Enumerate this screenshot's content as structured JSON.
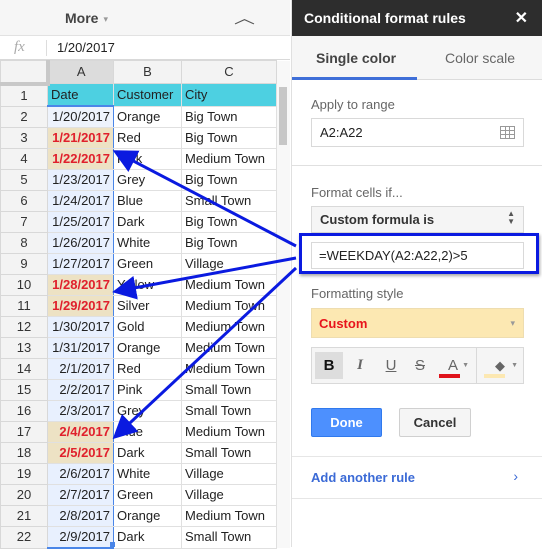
{
  "toolbar": {
    "more_label": "More",
    "more_caret": "▾",
    "collapse_icon": "︿"
  },
  "formula_bar": {
    "fx_label": "fx",
    "value": "1/20/2017"
  },
  "columns": [
    "A",
    "B",
    "C"
  ],
  "rows": [
    {
      "n": "1",
      "a": "Date",
      "b": "Customer",
      "c": "City"
    },
    {
      "n": "2",
      "a": "1/20/2017",
      "b": "Orange",
      "c": "Big Town"
    },
    {
      "n": "3",
      "a": "1/21/2017",
      "b": "Red",
      "c": "Big Town"
    },
    {
      "n": "4",
      "a": "1/22/2017",
      "b": "Pink",
      "c": "Medium Town"
    },
    {
      "n": "5",
      "a": "1/23/2017",
      "b": "Grey",
      "c": "Big Town"
    },
    {
      "n": "6",
      "a": "1/24/2017",
      "b": "Blue",
      "c": "Small Town"
    },
    {
      "n": "7",
      "a": "1/25/2017",
      "b": "Dark",
      "c": "Big Town"
    },
    {
      "n": "8",
      "a": "1/26/2017",
      "b": "White",
      "c": "Big Town"
    },
    {
      "n": "9",
      "a": "1/27/2017",
      "b": "Green",
      "c": "Village"
    },
    {
      "n": "10",
      "a": "1/28/2017",
      "b": "Yellow",
      "c": "Medium Town"
    },
    {
      "n": "11",
      "a": "1/29/2017",
      "b": "Silver",
      "c": "Medium Town"
    },
    {
      "n": "12",
      "a": "1/30/2017",
      "b": "Gold",
      "c": "Medium Town"
    },
    {
      "n": "13",
      "a": "1/31/2017",
      "b": "Orange",
      "c": "Medium Town"
    },
    {
      "n": "14",
      "a": "2/1/2017",
      "b": "Red",
      "c": "Medium Town"
    },
    {
      "n": "15",
      "a": "2/2/2017",
      "b": "Pink",
      "c": "Small Town"
    },
    {
      "n": "16",
      "a": "2/3/2017",
      "b": "Grey",
      "c": "Small Town"
    },
    {
      "n": "17",
      "a": "2/4/2017",
      "b": "Blue",
      "c": "Medium Town"
    },
    {
      "n": "18",
      "a": "2/5/2017",
      "b": "Dark",
      "c": "Small Town"
    },
    {
      "n": "19",
      "a": "2/6/2017",
      "b": "White",
      "c": "Village"
    },
    {
      "n": "20",
      "a": "2/7/2017",
      "b": "Green",
      "c": "Village"
    },
    {
      "n": "21",
      "a": "2/8/2017",
      "b": "Orange",
      "c": "Medium Town"
    },
    {
      "n": "22",
      "a": "2/9/2017",
      "b": "Dark",
      "c": "Small Town"
    }
  ],
  "highlighted_rows": [
    "3",
    "4",
    "10",
    "11",
    "17",
    "18"
  ],
  "colors": {
    "header_fill": "#4dd0e1",
    "highlight_fill": "#ede2c4",
    "highlight_text": "#e0202c",
    "selection": "#4a86e8",
    "annotation": "#0a1ae0",
    "done_button": "#4d90fe",
    "link": "#3b6ad6"
  },
  "panel": {
    "title": "Conditional format rules",
    "close_icon": "✕",
    "tabs": [
      {
        "label": "Single color",
        "active": true
      },
      {
        "label": "Color scale",
        "active": false
      }
    ],
    "apply_range_label": "Apply to range",
    "apply_range_value": "A2:A22",
    "format_if_label": "Format cells if...",
    "condition": "Custom formula is",
    "formula": "=WEEKDAY(A2:A22,2)>5",
    "formatting_style_label": "Formatting style",
    "style_value": "Custom",
    "style_caret": "▾",
    "format_buttons": {
      "bold": "B",
      "italic": "I",
      "underline": "U",
      "strikethrough": "S",
      "text_color": "A",
      "fill_color": "◆"
    },
    "done_label": "Done",
    "cancel_label": "Cancel",
    "add_rule_label": "Add another rule",
    "add_rule_chevron": "›"
  }
}
